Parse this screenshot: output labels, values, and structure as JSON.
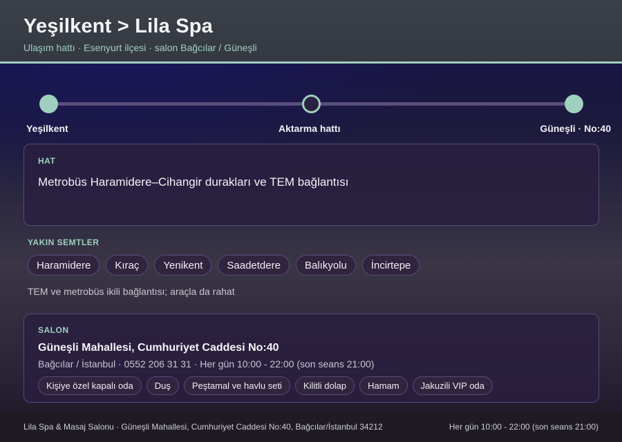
{
  "header": {
    "title": "Yeşilkent > Lila Spa",
    "subtitle": "Ulaşım hattı · Esenyurt ilçesi · salon Bağcılar / Güneşli"
  },
  "route": {
    "stops": [
      {
        "label": "Yeşilkent"
      },
      {
        "label": "Aktarma hattı"
      },
      {
        "label": "Güneşli · No:40"
      }
    ]
  },
  "hat": {
    "label": "HAT",
    "text": "Metrobüs Haramidere–Cihangir durakları ve TEM bağlantısı"
  },
  "semtler": {
    "label": "YAKIN SEMTLER",
    "items": [
      "Haramidere",
      "Kıraç",
      "Yenikent",
      "Saadetdere",
      "Balıkyolu",
      "İncirtepe"
    ],
    "note": "TEM ve metrobüs ikili bağlantısı; araçla da rahat"
  },
  "salon": {
    "label": "SALON",
    "name": "Güneşli Mahallesi, Cumhuriyet Caddesi No:40",
    "meta": "Bağcılar / İstanbul · 0552 206 31 31 · Her gün 10:00 - 22:00 (son seans 21:00)",
    "amenities": [
      "Kişiye özel kapalı oda",
      "Duş",
      "Peştamal ve havlu seti",
      "Kilitli dolap",
      "Hamam",
      "Jakuzili VIP oda"
    ]
  },
  "footer": {
    "left": "Lila Spa & Masaj Salonu · Güneşli Mahallesi, Cumhuriyet Caddesi No:40, Bağcılar/İstanbul 34212",
    "right": "Her gün 10:00 - 22:00 (son seans 21:00)"
  },
  "colors": {
    "accent": "#9fd0bf",
    "card_border": "#57497a",
    "route_line": "#5a4f7c"
  }
}
